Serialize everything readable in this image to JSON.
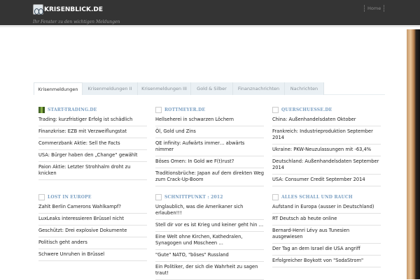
{
  "header": {
    "site_name": "KRISENBLICK.DE",
    "tagline": "Ihr Fenster zu den wichtigen Meldungen",
    "nav_home": "Home"
  },
  "tabs": [
    "Krisenmeldungen",
    "Krisenmeldungen II",
    "Krisenmeldungen III",
    "Gold & Silber",
    "Finanznachrichten",
    "Nachrichten"
  ],
  "sections": [
    {
      "title": "START-TRADING.DE",
      "items": [
        "Trading: kurzfristiger Erfolg ist schädlich",
        "Finanzkrise: EZB mit Verzweiflungstat",
        "Commerzbank Aktie: Sell the Facts",
        "USA: Bürger haben den „Change“ gewählt",
        "Paion Aktie: Letzter Strohhalm droht zu knicken"
      ]
    },
    {
      "title": "ROTTMEYER.DE",
      "items": [
        "Hellseherei in schwarzen Löchern",
        "Öl, Gold und Zins",
        "QE infinity: Aufwärts immer… abwärts nimmer",
        "Böses Omen: In Gold we F(t)rust?",
        "Traditionsbrüche: Japan auf dem direkten Weg zum Crack-Up-Boom"
      ]
    },
    {
      "title": "QUERSCHUESSE.DE",
      "items": [
        "China: Außenhandelsdaten Oktober",
        "Frankreich: Industrieproduktion September 2014",
        "Ukraine: PKW-Neuzulassungen mit -63,4%",
        "Deutschland: Außenhandelsdaten September 2014",
        "USA: Consumer Credit September 2014"
      ]
    },
    {
      "title": "LOST IN EUROPE",
      "items": [
        "Zahlt Berlin Camerons Wahlkampf?",
        "LuxLeaks interessieren Brüssel nicht",
        "Geschützt: Drei explosive Dokumente",
        "Politisch geht anders",
        "Schwere Unruhen in Brüssel"
      ]
    },
    {
      "title": "SCHNITTPUNKT : 2012",
      "items": [
        "Unglaublich, was die Amerikaner sich erlauben!!!",
        "Stell dir vor es ist Krieg und keiner geht hin …",
        "Eine Welt ohne Kirchen, Kathedralen, Synagogen und Moscheen …",
        "\"Gute\" NATO, \"böses\" Russland",
        "Ein Politiker, der sich die Wahrheit zu sagen traut!"
      ]
    },
    {
      "title": "ALLES SCHALL UND RAUCH",
      "items": [
        "Aufstand in Europa (ausser in Deutschland)",
        "RT Deutsch ab heute online",
        "Bernard-Henri Lévy aus Tunesien ausgewiesen",
        "Der Tag an dem Israel die USA angriff",
        "Erfolgreicher Boykott von \"SodaStrom\""
      ]
    }
  ]
}
